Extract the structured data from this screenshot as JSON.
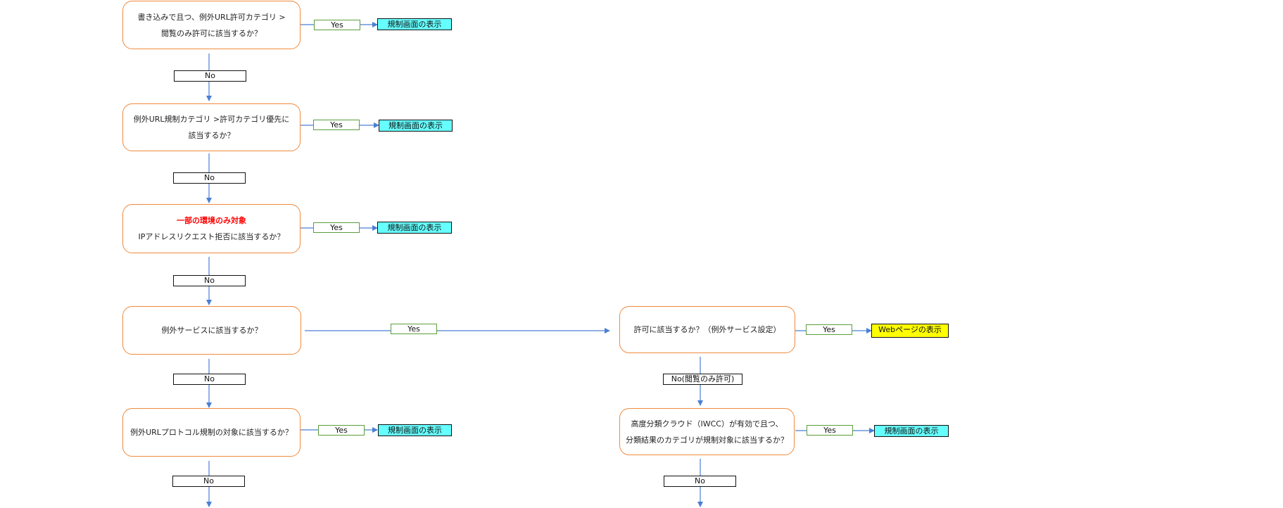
{
  "colors": {
    "decision_border": "#f08a3c",
    "yes_border": "#5a9e3a",
    "arrow": "#4a7fd4",
    "result_blocked": "#66ffff",
    "result_allowed": "#ffff00",
    "highlight_text": "#ff0000"
  },
  "flow": {
    "d1": {
      "line1": "書き込みで且つ、例外URL許可カテゴリ >",
      "line2": "閲覧のみ許可に該当するか？"
    },
    "d2": {
      "line1": "例外URL規制カテゴリ >許可カテゴリ優先に",
      "line2": "該当するか？"
    },
    "d3": {
      "note": "一部の環境のみ対象",
      "line1": "IPアドレスリクエスト拒否に該当するか？"
    },
    "d4": {
      "line1": "例外サービスに該当するか？"
    },
    "d5": {
      "line1": "例外URLプロトコル規制の対象に該当するか？"
    },
    "d6": {
      "line1": "許可に該当するか？（例外サービス設定）"
    },
    "d7": {
      "line1": "高度分類クラウド（IWCC）が有効で且つ、",
      "line2": "分類結果のカテゴリが規制対象に該当するか？"
    }
  },
  "labels": {
    "yes": "Yes",
    "no": "No",
    "no_browse_only": "No(閲覧のみ許可)"
  },
  "results": {
    "blocked": "規制画面の表示",
    "webpage": "Webページの表示"
  }
}
